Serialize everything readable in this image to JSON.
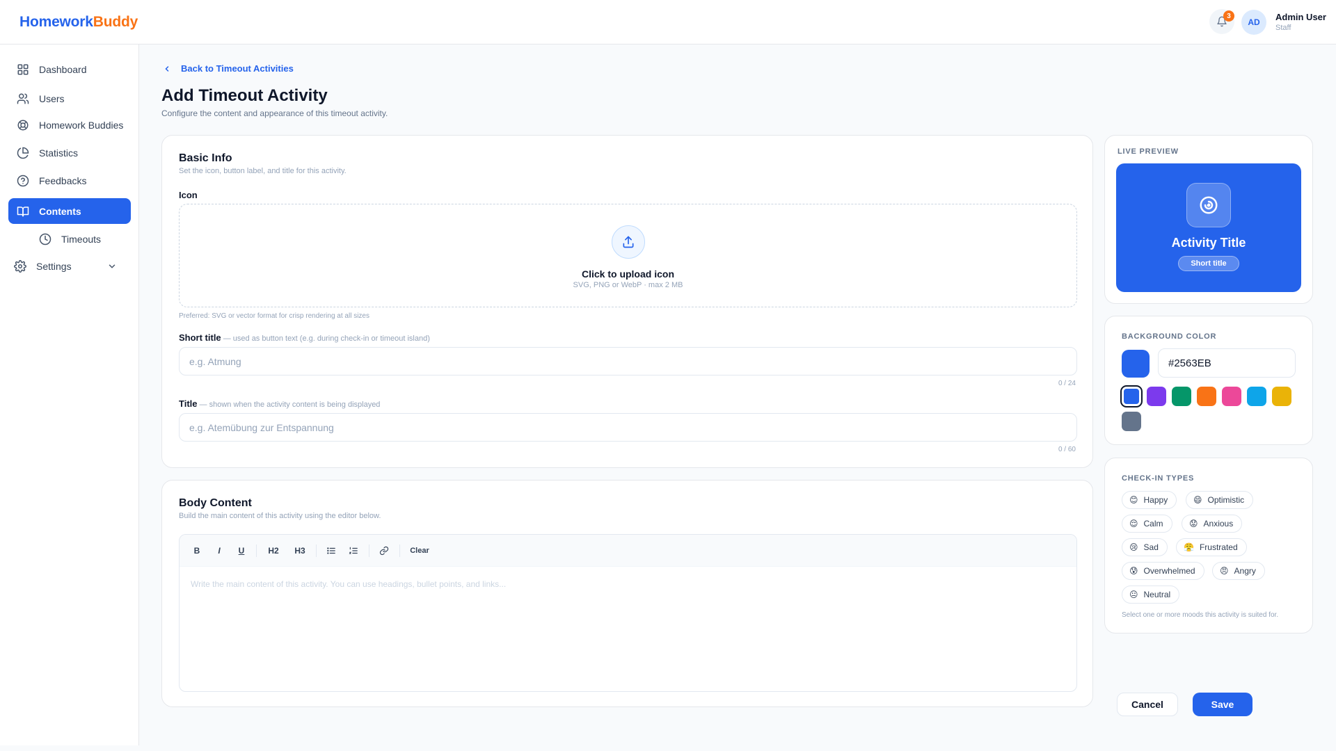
{
  "brand": {
    "name_part1": "Homework",
    "name_part2": "Buddy"
  },
  "header": {
    "notification_count": "3",
    "avatar_initials": "AD",
    "user_name": "Admin User",
    "user_role": "Staff"
  },
  "sidebar": {
    "items": [
      {
        "label": "Dashboard",
        "icon": "grid-icon"
      },
      {
        "label": "Users",
        "icon": "users-icon"
      },
      {
        "label": "Homework Buddies",
        "icon": "lifebuoy-icon"
      },
      {
        "label": "Statistics",
        "icon": "pie-chart-icon"
      },
      {
        "label": "Feedbacks",
        "icon": "help-circle-icon"
      },
      {
        "label": "Contents",
        "icon": "book-icon",
        "active": true
      },
      {
        "label": "Timeouts",
        "icon": "clock-icon",
        "sub": true
      },
      {
        "label": "Settings",
        "icon": "gear-icon",
        "expandable": true
      }
    ]
  },
  "page": {
    "back_link": "Back to Timeout Activities",
    "title": "Add Timeout Activity",
    "subtitle": "Configure the content and appearance of this timeout activity."
  },
  "basic_info": {
    "title": "Basic Info",
    "subtitle": "Set the icon, button label, and title for this activity.",
    "icon_label": "Icon",
    "upload_title": "Click to upload icon",
    "upload_sub": "SVG, PNG or WebP · max 2 MB",
    "upload_note": "Preferred: SVG or vector format for crisp rendering at all sizes",
    "short_title_label": "Short title",
    "short_title_hint": " — used as button text (e.g. during check-in or timeout island)",
    "short_title_placeholder": "e.g. Atmung",
    "short_title_counter": "0 / 24",
    "title_label": "Title",
    "title_hint": " — shown when the activity content is being displayed",
    "title_placeholder": "e.g. Atemübung zur Entspannung",
    "title_counter": "0 / 60"
  },
  "body_content": {
    "title": "Body Content",
    "subtitle": "Build the main content of this activity using the editor below.",
    "toolbar": {
      "bold": "B",
      "italic": "I",
      "underline": "U",
      "h2": "H2",
      "h3": "H3",
      "clear": "Clear"
    },
    "placeholder": "Write the main content of this activity. You can use headings, bullet points, and links..."
  },
  "live_preview": {
    "label": "LIVE PREVIEW",
    "title": "Activity Title",
    "chip": "Short title",
    "icon": "spiral-icon"
  },
  "background_color": {
    "label": "BACKGROUND COLOR",
    "value": "#2563EB",
    "selected": "#2563EB",
    "swatches": [
      "#2563EB",
      "#7C3AED",
      "#059669",
      "#F97316",
      "#EC4899",
      "#0EA5E9",
      "#EAB308",
      "#64748B"
    ]
  },
  "check_in_types": {
    "label": "CHECK-IN TYPES",
    "items": [
      {
        "label": "Happy",
        "emoji": "😊"
      },
      {
        "label": "Optimistic",
        "emoji": "😄"
      },
      {
        "label": "Calm",
        "emoji": "😌"
      },
      {
        "label": "Anxious",
        "emoji": "😟"
      },
      {
        "label": "Sad",
        "emoji": "😢"
      },
      {
        "label": "Frustrated",
        "emoji": "😤"
      },
      {
        "label": "Overwhelmed",
        "emoji": "😰"
      },
      {
        "label": "Angry",
        "emoji": "😠"
      },
      {
        "label": "Neutral",
        "emoji": "😐"
      }
    ],
    "note": "Select one or more moods this activity is suited for."
  },
  "actions": {
    "cancel": "Cancel",
    "save": "Save"
  }
}
